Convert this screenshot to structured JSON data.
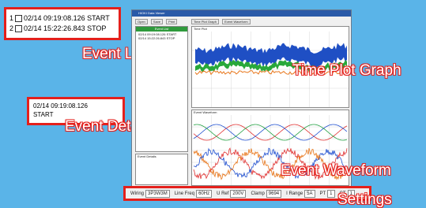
{
  "colors": {
    "background": "#5ab4e8",
    "callout_border": "#e4201c",
    "titlebar": "#2a5aa8"
  },
  "callouts": {
    "event_list": "Event List",
    "event_details": "Event Details",
    "time_plot": "Time Plot Graph",
    "event_waveform": "Event Waveform",
    "settings": "Settings"
  },
  "event_list_zoom": [
    {
      "index": "1",
      "text": "02/14 09:19:08.126 START"
    },
    {
      "index": "2",
      "text": "02/14 15:22:26.843 STOP"
    }
  ],
  "event_details_zoom": {
    "line1": "02/14 09:19:08.126",
    "line2": "START"
  },
  "app": {
    "title": "HIOKI Data Viewer",
    "toolbar": {
      "left": [
        "Open",
        "Save",
        "Print"
      ],
      "right": [
        "Time Plot Graph",
        "Event Waveform"
      ]
    },
    "event_list_header": "Event List",
    "events": [
      "02/14 09:19:08.126 START",
      "02/14 15:22:26.843 STOP"
    ],
    "time_plot_label": "Time Plot",
    "waveform_label": "Event Waveform",
    "details_label": "Event Details"
  },
  "settings": [
    {
      "label": "Wiring",
      "value": "3P3W3M"
    },
    {
      "label": "Line Freq",
      "value": "60Hz"
    },
    {
      "label": "U Ref",
      "value": "200V"
    },
    {
      "label": "Clamp",
      "value": "9694"
    },
    {
      "label": "I Range",
      "value": "5A"
    },
    {
      "label": "PT",
      "value": "1"
    },
    {
      "label": "CT",
      "value": "1"
    }
  ]
}
